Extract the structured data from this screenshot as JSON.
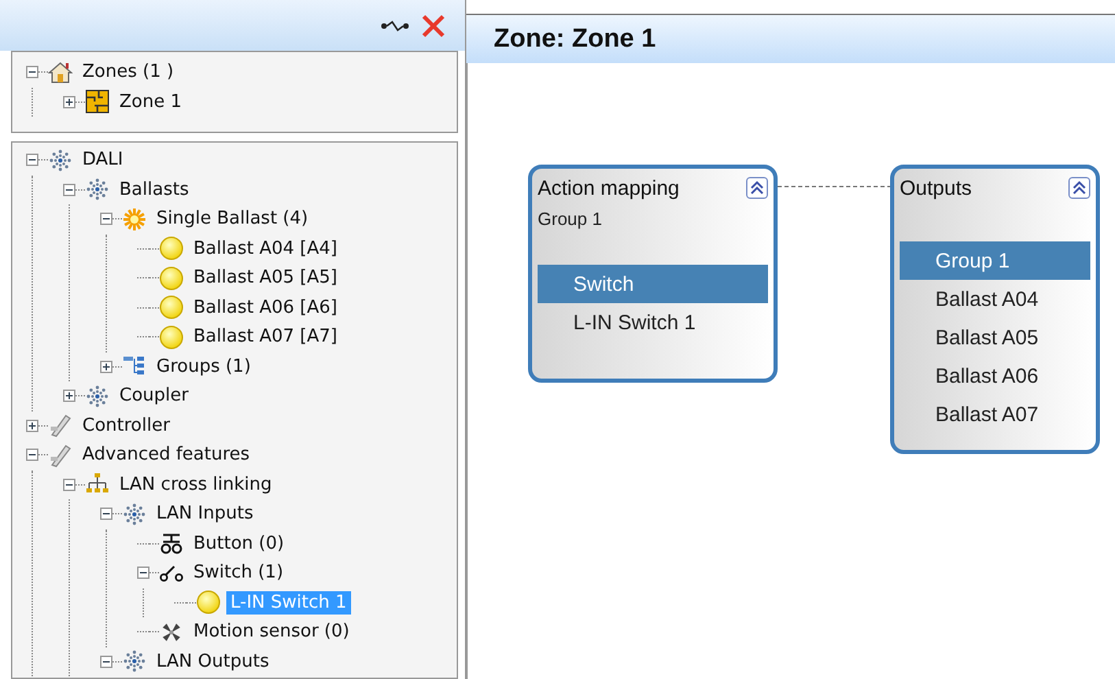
{
  "sidebar": {
    "zones_tree": [
      {
        "label": "Zones (1 )",
        "kind": "home",
        "expanded": true,
        "selected": false,
        "children": [
          {
            "label": "Zone 1",
            "kind": "zone",
            "expanded": false,
            "selected": false
          }
        ]
      }
    ],
    "device_tree": [
      {
        "label": "DALI",
        "kind": "network",
        "expanded": true,
        "selected": false,
        "children": [
          {
            "label": "Ballasts",
            "kind": "network",
            "expanded": true,
            "selected": false,
            "children": [
              {
                "label": "Single Ballast (4)",
                "kind": "starburst",
                "expanded": true,
                "selected": false,
                "children": [
                  {
                    "label": "Ballast A04 [A4]",
                    "kind": "bulb",
                    "selected": false
                  },
                  {
                    "label": "Ballast A05 [A5]",
                    "kind": "bulb",
                    "selected": false
                  },
                  {
                    "label": "Ballast A06 [A6]",
                    "kind": "bulb",
                    "selected": false
                  },
                  {
                    "label": "Ballast A07 [A7]",
                    "kind": "bulb",
                    "selected": false
                  }
                ]
              },
              {
                "label": "Groups (1)",
                "kind": "groups",
                "expanded": false,
                "selected": false
              }
            ]
          },
          {
            "label": "Coupler",
            "kind": "network",
            "expanded": false,
            "selected": false
          }
        ]
      },
      {
        "label": "Controller",
        "kind": "controller",
        "expanded": false,
        "selected": false
      },
      {
        "label": "Advanced features",
        "kind": "controller",
        "expanded": true,
        "selected": false,
        "children": [
          {
            "label": "LAN cross linking",
            "kind": "lan",
            "expanded": true,
            "selected": false,
            "children": [
              {
                "label": "LAN Inputs",
                "kind": "network",
                "expanded": true,
                "selected": false,
                "children": [
                  {
                    "label": "Button (0)",
                    "kind": "button",
                    "selected": false
                  },
                  {
                    "label": "Switch (1)",
                    "kind": "switch",
                    "expanded": true,
                    "selected": false,
                    "children": [
                      {
                        "label": "L-IN Switch 1",
                        "kind": "bulb",
                        "selected": true
                      }
                    ]
                  },
                  {
                    "label": "Motion sensor (0)",
                    "kind": "motion",
                    "selected": false
                  }
                ]
              },
              {
                "label": "LAN Outputs",
                "kind": "network",
                "expanded": true,
                "selected": false
              }
            ]
          }
        ]
      }
    ]
  },
  "editor": {
    "title": "Zone: Zone 1",
    "nodes": [
      {
        "title": "Action mapping",
        "subtitle": "Group 1",
        "items": [
          {
            "label": "Switch",
            "selected": true
          },
          {
            "label": "L-IN Switch 1",
            "selected": false
          }
        ]
      },
      {
        "title": "Outputs",
        "items": [
          {
            "label": "Group 1",
            "selected": true
          },
          {
            "label": "Ballast A04",
            "selected": false
          },
          {
            "label": "Ballast A05",
            "selected": false
          },
          {
            "label": "Ballast A06",
            "selected": false
          },
          {
            "label": "Ballast A07",
            "selected": false
          }
        ]
      }
    ]
  }
}
